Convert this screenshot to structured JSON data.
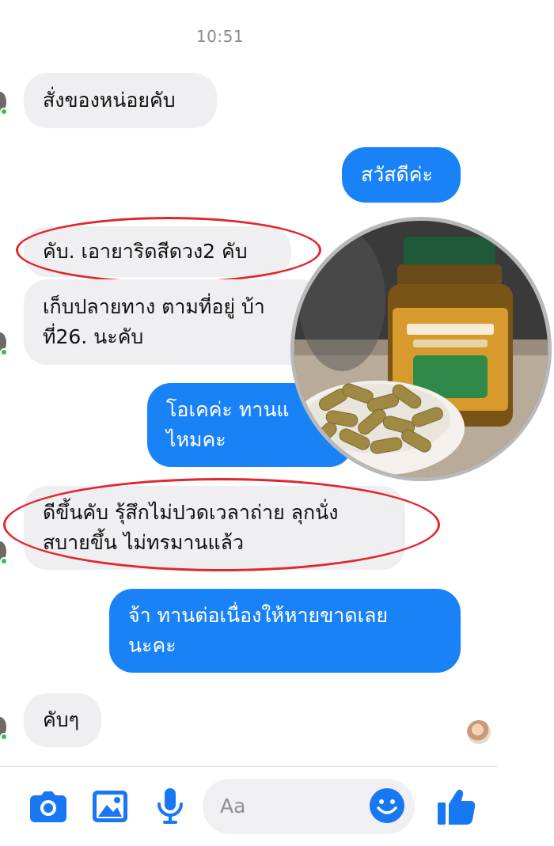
{
  "conversation": {
    "timestamp": "10:51",
    "messages": [
      {
        "from": "contact",
        "text": "สั่งของหน่อยคับ"
      },
      {
        "from": "me",
        "text": "สวัสดีค่ะ"
      },
      {
        "from": "contact",
        "text": "คับ. เอายาริดสีดวง2 คับ",
        "circled": true
      },
      {
        "from": "contact",
        "lines": [
          "เก็บปลายทาง ตามที่อยู่ บ้า",
          "ที่26. นะคับ"
        ]
      },
      {
        "from": "me",
        "lines": [
          "โอเคค่ะ  ทานแ",
          "ไหมคะ"
        ]
      },
      {
        "from": "contact",
        "lines": [
          "ดีขึ้นคับ รุ้สึกไม่ปวดเวลาถ่าย  ลุกนั่ง",
          "สบายขึ้น ไม่ทรมานแล้ว"
        ],
        "circled": true
      },
      {
        "from": "me",
        "lines": [
          "จ้า ทานต่อเนื่องให้หายขาดเลย",
          "นะคะ"
        ]
      },
      {
        "from": "contact",
        "text": "คับๆ"
      }
    ]
  },
  "overlay_image": {
    "subject": "product-bottle-with-herbal-capsules"
  },
  "composer": {
    "placeholder": "Aa",
    "icons": [
      "camera-icon",
      "image-icon",
      "microphone-icon",
      "emoji-icon",
      "thumbs-up-icon"
    ]
  },
  "colors": {
    "outgoing_bubble": "#1a82f7",
    "incoming_bubble": "#efeff1",
    "annotation_red": "#e1262e",
    "messenger_blue": "#1877f2"
  }
}
